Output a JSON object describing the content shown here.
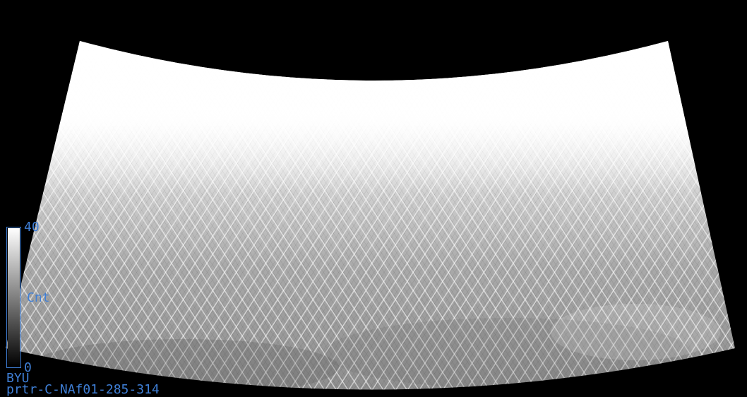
{
  "image": {
    "background_color": "#000000",
    "swath_color_high": "#ffffff",
    "swath_color_low": "#000000",
    "label_color": "#3f7fd6"
  },
  "colorbar": {
    "max_label": "40",
    "min_label": "0",
    "units_label": "Cnt",
    "min_value": 0,
    "max_value": 40
  },
  "footer": {
    "org_label": "BYU",
    "product_label": "prtr-C-NAf01-285-314"
  }
}
